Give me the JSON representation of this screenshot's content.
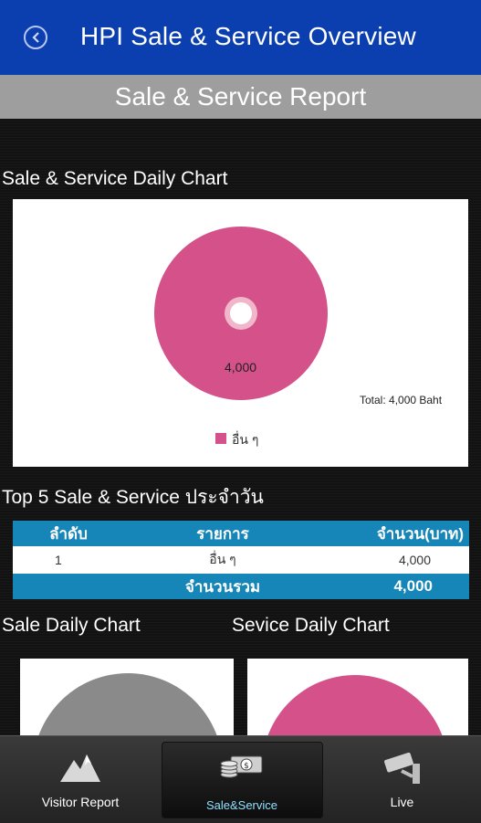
{
  "header": {
    "title": "HPI Sale & Service Overview",
    "back_icon": "back-arrow-icon"
  },
  "subheader": {
    "title": "Sale & Service Report"
  },
  "daily_chart": {
    "section_title": "Sale & Service Daily Chart",
    "value_label": "4,000",
    "total_label": "Total: 4,000 Baht",
    "legend_label": "อื่น ๆ",
    "color": "#d4518a"
  },
  "top5": {
    "section_title": "Top 5 Sale & Service ประจำวัน",
    "headers": [
      "ลำดับ",
      "รายการ",
      "จำนวน(บาท)"
    ],
    "rows": [
      {
        "rank": "1",
        "item": "อื่น ๆ",
        "amount": "4,000"
      }
    ],
    "total_label": "จำนวนรวม",
    "total_value": "4,000"
  },
  "sale_chart": {
    "section_title": "Sale Daily Chart",
    "color": "#8a8a8a"
  },
  "service_chart": {
    "section_title": "Sevice Daily Chart",
    "color": "#d4518a"
  },
  "chart_data": [
    {
      "type": "pie",
      "title": "Sale & Service Daily Chart",
      "categories": [
        "อื่น ๆ"
      ],
      "values": [
        4000
      ],
      "annotation": "Total: 4,000 Baht",
      "legend": "bottom"
    }
  ],
  "bottom_nav": {
    "items": [
      {
        "label": "Visitor Report",
        "icon": "mountain-icon"
      },
      {
        "label": "Sale&Service",
        "icon": "money-icon",
        "active": true
      },
      {
        "label": "Live",
        "icon": "cctv-camera-icon"
      }
    ]
  }
}
